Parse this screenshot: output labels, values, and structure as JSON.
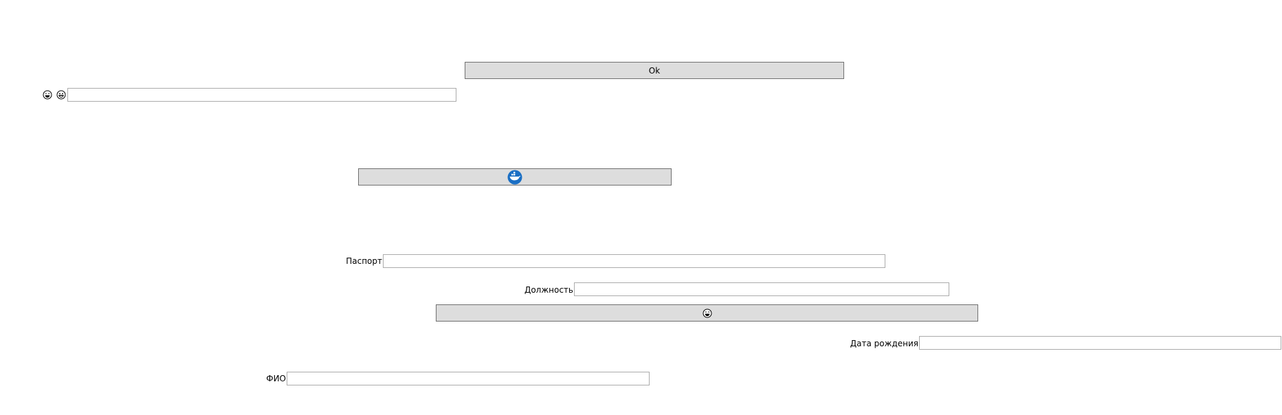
{
  "ok_button": {
    "label": "Ok"
  },
  "emoji_row": {
    "icons": [
      "laughing-face-icon",
      "grinning-face-icon"
    ],
    "input_value": ""
  },
  "image_button": {
    "icon": "docker-whale-icon",
    "accent": "#1b6fc4"
  },
  "passport": {
    "label": "Паспорт",
    "value": ""
  },
  "position": {
    "label": "Должность",
    "value": ""
  },
  "emoji_button": {
    "icon": "laughing-face-icon"
  },
  "birth_date": {
    "label": "Дата рождения",
    "value": ""
  },
  "full_name": {
    "label": "ФИО",
    "value": ""
  },
  "colors": {
    "button_bg": "#dddddd",
    "button_border": "#707070",
    "field_border": "#ababab"
  }
}
